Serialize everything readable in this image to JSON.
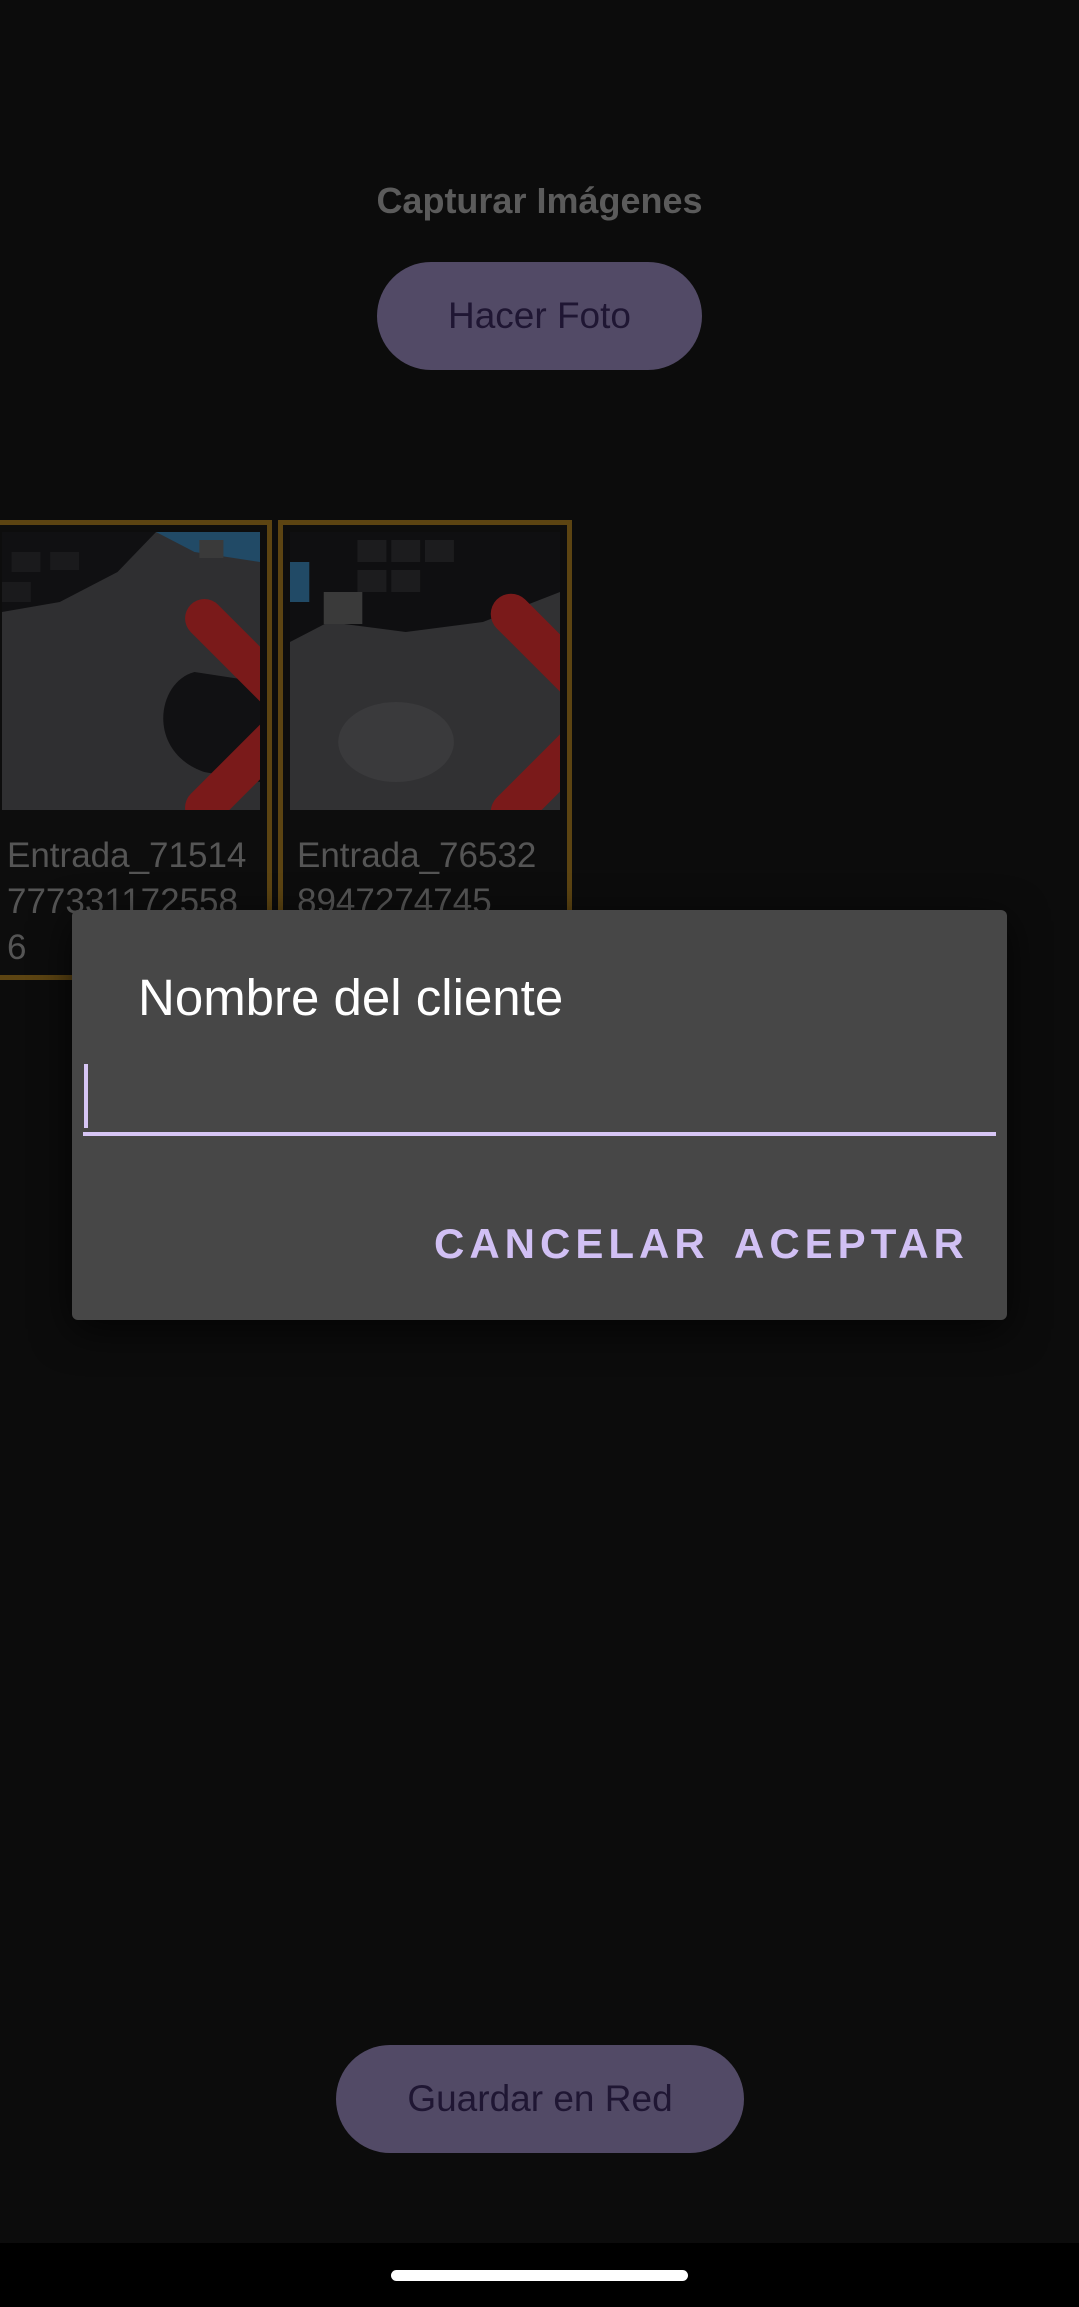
{
  "app": {
    "title": "Capturar Imágenes",
    "take_photo_label": "Hacer Foto",
    "save_label": "Guardar en Red"
  },
  "gallery": {
    "items": [
      {
        "name": "Entrada_715147773311725586",
        "visible_text": "Entrada_7151\n47773311725\n586",
        "delete_icon": "close-x-icon"
      },
      {
        "name": "Entrada_765328947274745",
        "visible_text": "Entrada_7653\n28947274745",
        "delete_icon": "close-x-icon"
      }
    ]
  },
  "dialog": {
    "title": "Nombre del cliente",
    "input_value": "",
    "input_placeholder": "",
    "cancel_label": "CANCELAR",
    "accept_label": "ACEPTAR"
  },
  "colors": {
    "background": "#0c0c0c",
    "dialog": "#474747",
    "accent": "#d1c0f4",
    "button_fill": "#524a66",
    "card_border": "#5c4412",
    "delete_red": "#7a1a1a"
  }
}
